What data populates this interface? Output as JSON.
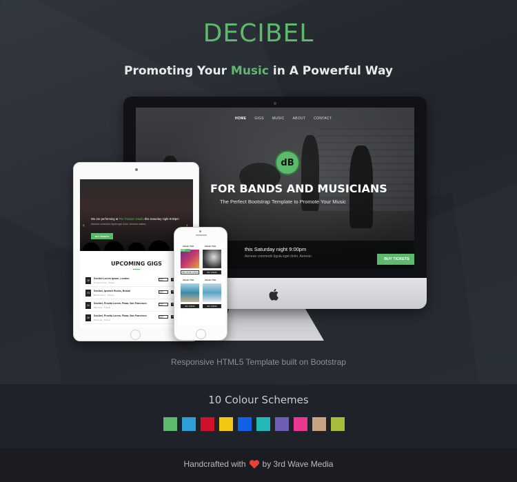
{
  "brand": "DECIBEL",
  "tagline": {
    "before": "Promoting Your ",
    "highlight": "Music",
    "after": " in A Powerful Way"
  },
  "imac": {
    "nav": [
      "HOME",
      "GIGS",
      "MUSIC",
      "ABOUT",
      "CONTACT"
    ],
    "logo_text": "dB",
    "headline": "FOR BANDS AND MUSICIANS",
    "subheadline": "The Perfect Bootstrap Template to Promote Your Music",
    "gig_text": "this Saturday night 9:00pm",
    "gig_subtext": "Aenean commodo ligula eget dolor. Aenean",
    "buy_label": "BUY TICKETS"
  },
  "ipad": {
    "gig_line_prefix": "We are performing at",
    "gig_line_venue": "The Passion Studio",
    "gig_line_suffix": "this Saturday night 9:00pm",
    "gig_sub": "Aenean commodo ligula eget dolor. Aenean massa.",
    "button_label": "BUY TICKETS",
    "section_title": "UPCOMING GIGS",
    "gigs": [
      {
        "date": "18",
        "name": "Decibel Lorem Ipsum, London",
        "loc": "Tonight Arena · Tickets"
      },
      {
        "date": "23",
        "name": "Decibel, Ipswich Rocks, Bristol",
        "loc": "Bristol Arena · Tickets"
      },
      {
        "date": "24",
        "name": "Decibel, Proctia Lorem, Plaza, San Francisco",
        "loc": "Moscone · Tickets"
      },
      {
        "date": "28",
        "name": "Decibel, Proctia Lorem, Plaza, San Francisco",
        "loc": "Moscone · Tickets"
      }
    ],
    "gig_btn1": "VIEW INFO",
    "gig_btn2": "TICKETS"
  },
  "iphone": {
    "album_title": "Album Title",
    "tag": "COMING SOON",
    "btn_listen": "PRE-ORDER ALBUM",
    "btn_buy": "BUY ALBUM"
  },
  "caption": "Responsive HTML5 Template built on Bootstrap",
  "schemes_title": "10 Colour Schemes",
  "swatches": [
    "#5dba6d",
    "#2d9fd6",
    "#d0112b",
    "#f3c614",
    "#1262e8",
    "#22b8b7",
    "#6f5fb4",
    "#e8378d",
    "#c5a384",
    "#a9bb3a"
  ],
  "footer": {
    "before": "Handcrafted with",
    "after": "by 3rd Wave Media",
    "heart_color": "#e5423e"
  }
}
